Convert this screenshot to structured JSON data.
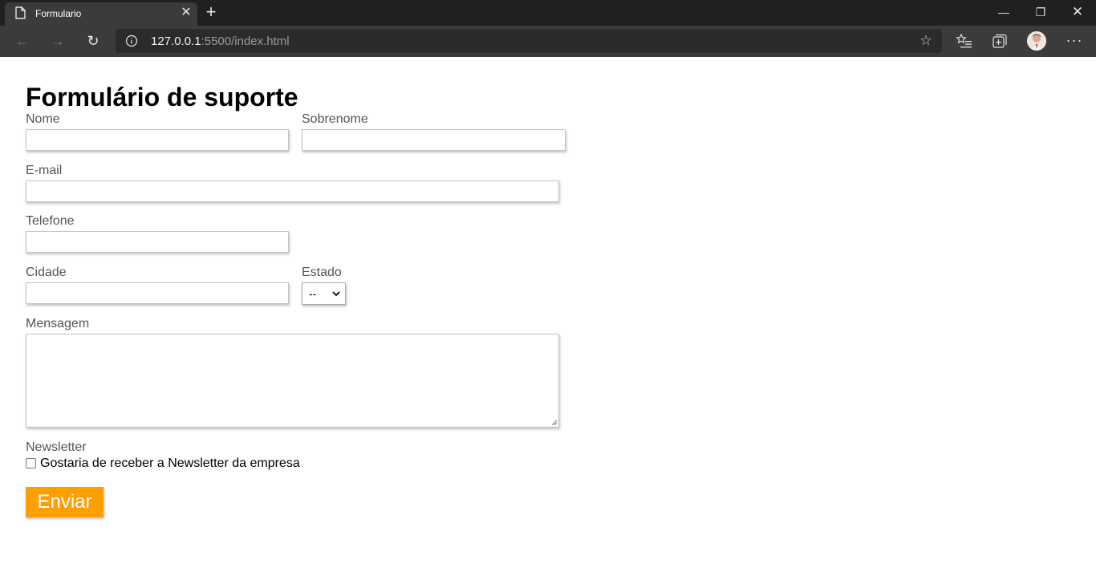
{
  "browser": {
    "tab": {
      "title": "Formulario",
      "close_glyph": "✕",
      "icon": "document-icon"
    },
    "new_tab_glyph": "+",
    "window_controls": {
      "minimize": "—",
      "maximize": "❐",
      "close": "✕"
    },
    "nav": {
      "back": "←",
      "forward": "→",
      "reload": "↻"
    },
    "address": {
      "host": "127.0.0.1",
      "rest": ":5500/index.html"
    },
    "star_glyph": "☆",
    "more_glyph": "···"
  },
  "form": {
    "title": "Formulário de suporte",
    "labels": {
      "nome": "Nome",
      "sobrenome": "Sobrenome",
      "email": "E-mail",
      "telefone": "Telefone",
      "cidade": "Cidade",
      "estado": "Estado",
      "mensagem": "Mensagem",
      "newsletter": "Newsletter"
    },
    "estado_selected": "--",
    "newsletter_checkbox_label": "Gostaria de receber a Newsletter da empresa",
    "newsletter_checked": false,
    "submit_label": "Enviar"
  },
  "colors": {
    "submit_bg": "#ff9e00",
    "tabbar_bg": "#202020",
    "toolbar_bg": "#3b3b3b"
  }
}
